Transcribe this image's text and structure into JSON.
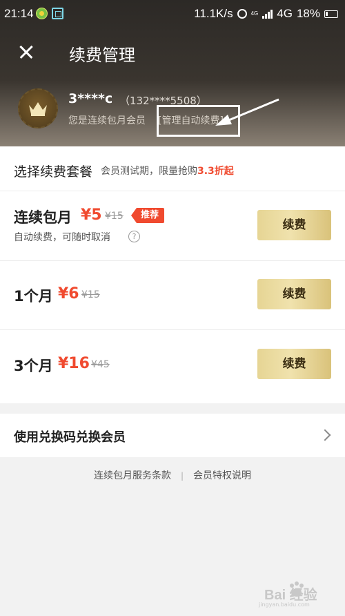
{
  "status_bar": {
    "time": "21:14",
    "speed": "11.1K/s",
    "network_small": "4G",
    "network": "4G",
    "battery": "18%"
  },
  "header": {
    "title": "续费管理",
    "username": "3****c",
    "phone": "（132****5508）",
    "member_desc": "您是连续包月会员",
    "manage_link": "[管理自动续费]"
  },
  "plans_section": {
    "title": "选择续费套餐",
    "subtitle_prefix": "会员测试期，限量抢购",
    "subtitle_highlight": "3.3折起"
  },
  "plans": [
    {
      "name": "连续包月",
      "price": "¥5",
      "original": "¥15",
      "badge": "推荐",
      "desc": "自动续费，可随时取消",
      "button": "续费"
    },
    {
      "name": "1个月",
      "price": "¥6",
      "original": "¥15",
      "button": "续费"
    },
    {
      "name": "3个月",
      "price": "¥16",
      "original": "¥45",
      "button": "续费"
    }
  ],
  "redeem": {
    "label": "使用兑换码兑换会员"
  },
  "footer": {
    "link1": "连续包月服务条款",
    "separator": "|",
    "link2": "会员特权说明"
  },
  "watermark": {
    "text": "Bai 经验",
    "url": "jingyan.baidu.com"
  },
  "colors": {
    "accent_red": "#f04a2f",
    "gold_button": "#e6d594",
    "header_dark": "#2c2926"
  }
}
